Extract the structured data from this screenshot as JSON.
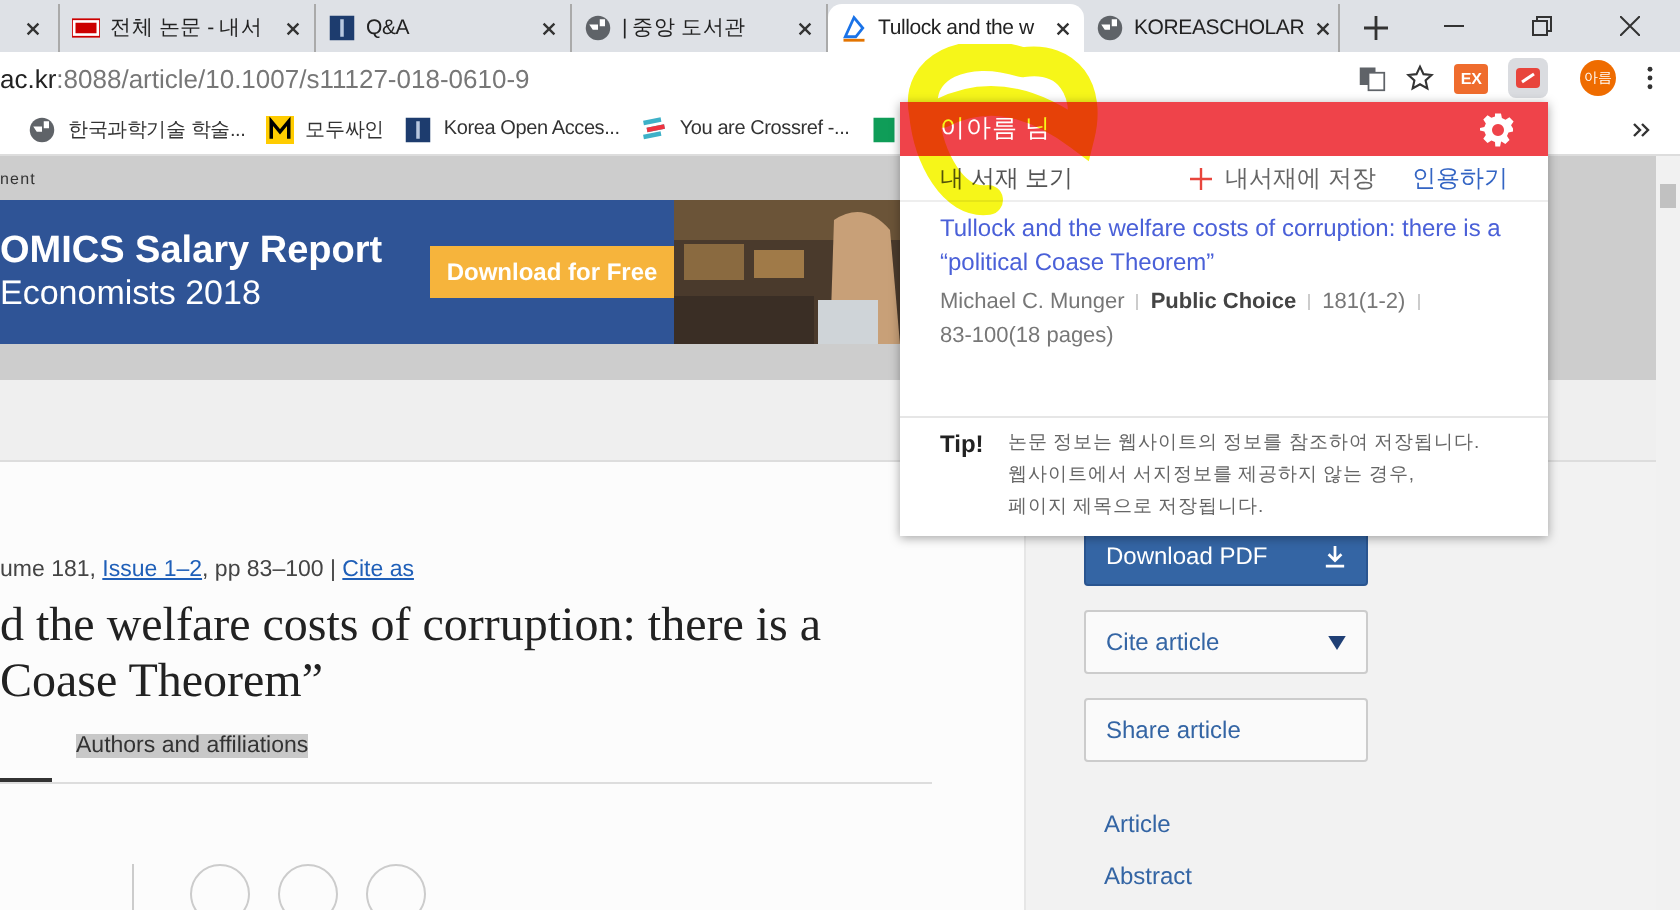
{
  "browser": {
    "tabs": [
      {
        "kind": "blank",
        "selected": false
      },
      {
        "title": "전체 논문 - 내서",
        "kind": "db",
        "selected": false
      },
      {
        "title": "Q&A",
        "kind": "book",
        "selected": false
      },
      {
        "title": "| 중앙 도서관",
        "kind": "globe",
        "selected": false
      },
      {
        "title": "Tullock and the w",
        "kind": "doc",
        "selected": true
      },
      {
        "title": "KOREASCHOLAR",
        "kind": "globe",
        "selected": false
      }
    ],
    "url_host": "ac.kr",
    "url_path": ":8088/article/10.1007/s11127-018-0610-9",
    "extension_badge": "EX",
    "profile": "아름",
    "bookmarks": [
      {
        "title": "한국과학기술 학술...",
        "kind": "globe"
      },
      {
        "title": "모두싸인",
        "kind": "m"
      },
      {
        "title": "Korea Open Acces...",
        "kind": "book"
      },
      {
        "title": "You are Crossref -...",
        "kind": "crossref"
      },
      {
        "kind": "sheet"
      }
    ]
  },
  "page": {
    "notice": "nent",
    "banner": {
      "headline": "OMICS Salary Report",
      "subline": "Economists 2018",
      "button": "Download for Free"
    },
    "meta": {
      "prefix": "ume 181, ",
      "issue": "Issue 1–2",
      "middle": ", pp 83–100 | ",
      "cite": "Cite as"
    },
    "title_lines": [
      "d the welfare costs of corruption: there is a",
      "Coase Theorem”"
    ],
    "tabs": [
      {
        "selected": true
      },
      {
        "label": "Authors and affiliations",
        "selected": false
      }
    ],
    "sidebar": {
      "download": "Download PDF",
      "cite": "Cite article",
      "share": "Share article",
      "nav": [
        "Article",
        "Abstract"
      ]
    }
  },
  "popup": {
    "user": "이아름 님",
    "view": "내 서재 보기",
    "save": "내서재에 저장",
    "cite": "인용하기",
    "item": {
      "title": "Tullock and the welfare costs of corruption: there is a “political Coase Theorem”",
      "author": "Michael C. Munger",
      "journal": "Public Choice",
      "issue": "181(1-2)",
      "pages": "83-100(18 pages)"
    },
    "tip_label": "Tip!",
    "tip_lines": [
      "논문 정보는 웹사이트의 정보를 참조하여 저장됩니다.",
      "웹사이트에서 서지정보를 제공하지 않는 경우,",
      "페이지 제목으로 저장됩니다."
    ]
  }
}
